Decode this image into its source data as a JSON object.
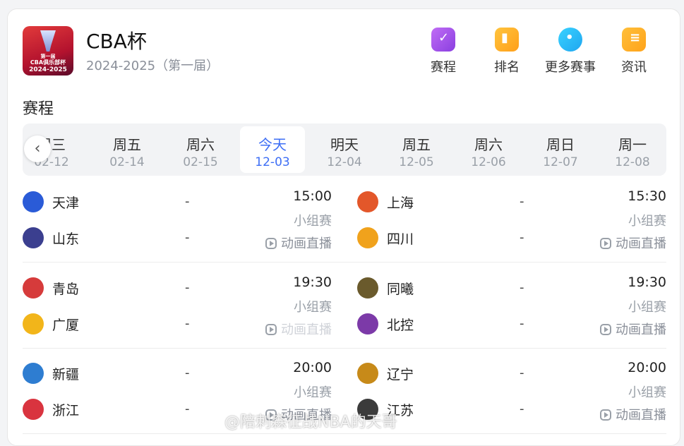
{
  "header": {
    "title": "CBA杯",
    "season": "2024-2025（第一届）",
    "logo": {
      "line1": "第一届",
      "line2": "CBA俱乐部杯",
      "line3": "2024-2025"
    }
  },
  "nav": [
    {
      "label": "赛程",
      "icon": "schedule-icon"
    },
    {
      "label": "排名",
      "icon": "ranking-icon"
    },
    {
      "label": "更多赛事",
      "icon": "more-events-icon"
    },
    {
      "label": "资讯",
      "icon": "news-icon"
    }
  ],
  "section": {
    "title": "赛程"
  },
  "dates": [
    {
      "weekday": "周三",
      "date": "02-12"
    },
    {
      "weekday": "周五",
      "date": "02-14"
    },
    {
      "weekday": "周六",
      "date": "02-15"
    },
    {
      "weekday": "今天",
      "date": "12-03",
      "active": true
    },
    {
      "weekday": "明天",
      "date": "12-04"
    },
    {
      "weekday": "周五",
      "date": "12-05"
    },
    {
      "weekday": "周六",
      "date": "12-06"
    },
    {
      "weekday": "周日",
      "date": "12-07"
    },
    {
      "weekday": "周一",
      "date": "12-08"
    }
  ],
  "matches": [
    {
      "home": "天津",
      "away": "山东",
      "home_score": "-",
      "away_score": "-",
      "time": "15:00",
      "stage": "小组赛",
      "live": "动画直播",
      "home_color": "#2a5bd7",
      "away_color": "#3b3f8f"
    },
    {
      "home": "上海",
      "away": "四川",
      "home_score": "-",
      "away_score": "-",
      "time": "15:30",
      "stage": "小组赛",
      "live": "动画直播",
      "home_color": "#e3572a",
      "away_color": "#f0a21c"
    },
    {
      "home": "青岛",
      "away": "广厦",
      "home_score": "-",
      "away_score": "-",
      "time": "19:30",
      "stage": "小组赛",
      "live": "动画直播",
      "home_color": "#d63b3b",
      "away_color": "#f2b51a"
    },
    {
      "home": "同曦",
      "away": "北控",
      "home_score": "-",
      "away_score": "-",
      "time": "19:30",
      "stage": "小组赛",
      "live": "动画直播",
      "home_color": "#6a5a2c",
      "away_color": "#7c3aa8"
    },
    {
      "home": "新疆",
      "away": "浙江",
      "home_score": "-",
      "away_score": "-",
      "time": "20:00",
      "stage": "小组赛",
      "live": "动画直播",
      "home_color": "#2e7dd1",
      "away_color": "#d9343f"
    },
    {
      "home": "辽宁",
      "away": "江苏",
      "home_score": "-",
      "away_score": "-",
      "time": "20:00",
      "stage": "小组赛",
      "live": "动画直播",
      "home_color": "#c78a19",
      "away_color": "#3b3b3b"
    }
  ],
  "watermark": "@陪刺森征战NBA的天哥"
}
